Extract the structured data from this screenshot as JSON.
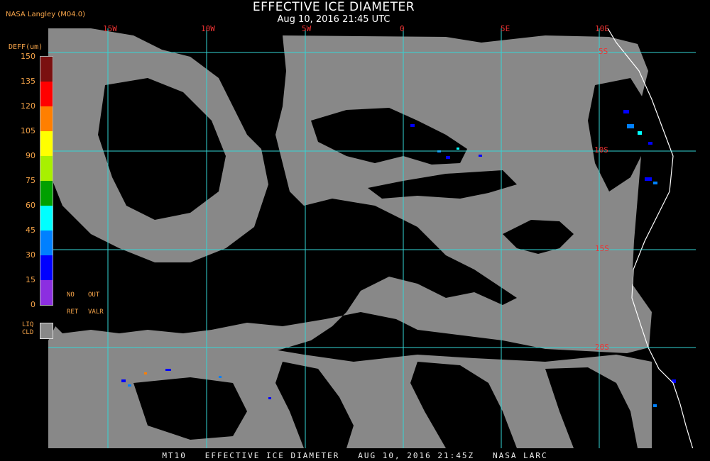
{
  "header": {
    "title": "EFFECTIVE ICE DIAMETER",
    "subtitle": "Aug 10, 2016 21:45 UTC",
    "org": "NASA Langley (M04.0)"
  },
  "map": {
    "longitude_labels": [
      "15W",
      "10W",
      "5W",
      "0",
      "5E",
      "10E"
    ],
    "latitude_labels": [
      "5S",
      "10S",
      "15S",
      "20S"
    ],
    "colors": {
      "background": "#000000",
      "liquid_cloud": "#888888",
      "grid": "#33d6d6",
      "coast": "#ffffff",
      "graticule_label": "#ee3333"
    }
  },
  "legend": {
    "title": "DEFF(um)",
    "ticks": [
      "150",
      "135",
      "120",
      "105",
      "90",
      "75",
      "60",
      "45",
      "30",
      "15",
      "0"
    ],
    "colors": [
      "#7a1010",
      "#ff0000",
      "#ff7f00",
      "#ffff00",
      "#a8f000",
      "#00a000",
      "#00ffff",
      "#0080ff",
      "#0000ff",
      "#8c2ee0"
    ],
    "no_ret": "NO\nRET",
    "out_valr": "OUT\nVALR",
    "liq_cld": "LIQ\nCLD"
  },
  "footer": "MT10   EFFECTIVE ICE DIAMETER   AUG 10, 2016 21:45Z   NASA LARC"
}
